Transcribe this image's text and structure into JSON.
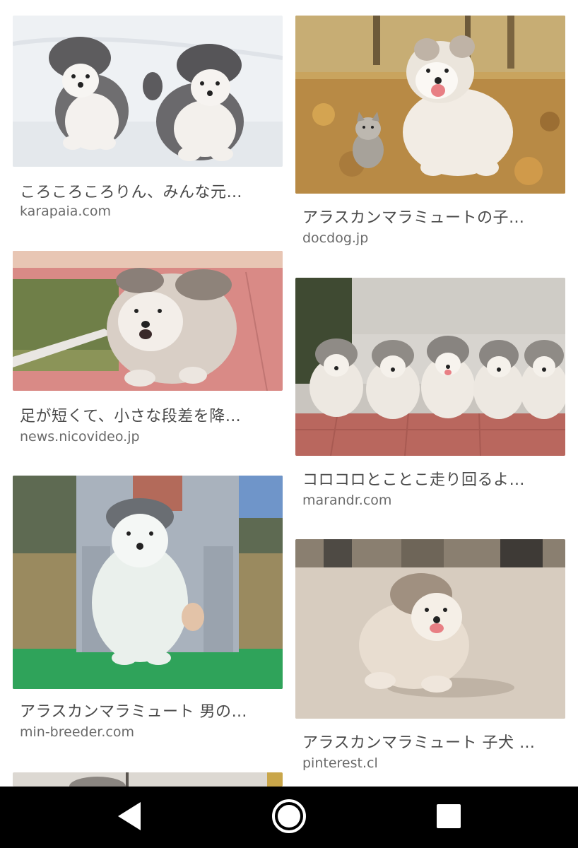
{
  "results": [
    {
      "title": "ころころころりん、みんな元…",
      "domain": "karapaia.com",
      "image": "two-malamute-puppies-in-snow"
    },
    {
      "title": "アラスカンマラミュートの子…",
      "domain": "docdog.jp",
      "image": "malamute-puppy-and-kitten-autumn-leaves"
    },
    {
      "title": "足が短くて、小さな段差を降…",
      "domain": "news.nicovideo.jp",
      "image": "fluffy-puppy-on-red-path"
    },
    {
      "title": "コロコロとことこ走り回るよ…",
      "domain": "marandr.com",
      "image": "five-puppies-in-a-row"
    },
    {
      "title": "アラスカンマラミュート 男の…",
      "domain": "min-breeder.com",
      "image": "puppy-held-on-green-mat"
    },
    {
      "title": "アラスカンマラミュート 子犬 …",
      "domain": "pinterest.cl",
      "image": "puppy-running-on-pavement"
    }
  ],
  "navbar": {
    "back": "back-icon",
    "home": "home-icon",
    "recents": "recents-icon"
  },
  "colors": {
    "navbar": "#000000",
    "title": "#4a4a4a",
    "domain": "#6a6a6a"
  }
}
